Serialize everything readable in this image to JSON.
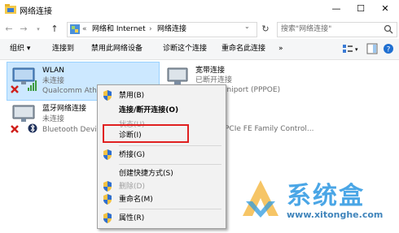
{
  "window": {
    "title": "网络连接",
    "controls": {
      "minimize": "—",
      "maximize": "☐",
      "close": "✕"
    }
  },
  "address": {
    "prefix": "«",
    "crumbs": [
      "网络和 Internet",
      "网络连接"
    ],
    "separator": "›",
    "search_placeholder": "搜索\"网络连接\""
  },
  "toolbar": {
    "items": [
      "组织 ▾",
      "连接到",
      "禁用此网络设备",
      "诊断这个连接",
      "重命名此连接",
      "»"
    ]
  },
  "connections": [
    {
      "name": "WLAN",
      "status": "未连接",
      "adapter": "Qualcomm Athe",
      "icon": "wifi-adapter-icon"
    },
    {
      "name": "蓝牙网络连接",
      "status": "未连接",
      "adapter": "Bluetooth Devic",
      "icon": "bluetooth-adapter-icon"
    },
    {
      "name": "宽带连接",
      "status": "已断开连接",
      "adapter": "iniport (PPPOE)",
      "icon": "broadband-icon"
    },
    {
      "name": "",
      "status": "",
      "adapter": "PCIe FE Family Control...",
      "icon": "ethernet-icon"
    }
  ],
  "context_menu": {
    "items": [
      {
        "label": "禁用(B)",
        "shield": true,
        "disabled": false,
        "bold": false
      },
      {
        "label": "连接/断开连接(O)",
        "shield": false,
        "disabled": false,
        "bold": true
      },
      {
        "label": "状态(U)",
        "shield": false,
        "disabled": true,
        "bold": false
      },
      {
        "label": "诊断(I)",
        "shield": false,
        "disabled": false,
        "bold": false
      },
      {
        "label": "桥接(G)",
        "shield": true,
        "disabled": false,
        "bold": false
      },
      {
        "label": "创建快捷方式(S)",
        "shield": false,
        "disabled": false,
        "bold": false
      },
      {
        "label": "删除(D)",
        "shield": true,
        "disabled": true,
        "bold": false
      },
      {
        "label": "重命名(M)",
        "shield": true,
        "disabled": false,
        "bold": false
      },
      {
        "label": "属性(R)",
        "shield": true,
        "disabled": false,
        "bold": false
      }
    ]
  },
  "watermark": {
    "brand": "系统盒",
    "url": "www.xitonghe.com"
  },
  "colors": {
    "selection": "#cce8ff",
    "highlight_border": "#e02020",
    "watermark": "#1e90e0"
  }
}
